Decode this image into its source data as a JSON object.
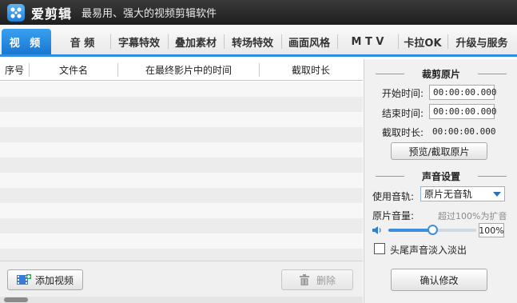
{
  "app": {
    "name": "爱剪辑",
    "slogan": "最易用、强大的视频剪辑软件"
  },
  "tabs": [
    {
      "label": "视 频",
      "active": true
    },
    {
      "label": "音 频"
    },
    {
      "label": "字幕特效"
    },
    {
      "label": "叠加素材"
    },
    {
      "label": "转场特效"
    },
    {
      "label": "画面风格"
    },
    {
      "label": "M T V"
    },
    {
      "label": "卡拉OK"
    },
    {
      "label": "升级与服务"
    }
  ],
  "list": {
    "columns": [
      "序号",
      "文件名",
      "在最终影片中的时间",
      "截取时长"
    ],
    "add_button": "添加视频",
    "delete_button": "删除"
  },
  "clip": {
    "section_title": "裁剪原片",
    "start_label": "开始时间:",
    "start_value": "00:00:00.000",
    "end_label": "结束时间:",
    "end_value": "00:00:00.000",
    "duration_label": "截取时长:",
    "duration_value": "00:00:00.000",
    "preview_button": "预览/截取原片"
  },
  "audio": {
    "section_title": "声音设置",
    "track_label": "使用音轨:",
    "track_value": "原片无音轨",
    "volume_label": "原片音量:",
    "volume_hint": "超过100%为扩音",
    "volume_percent": "100%",
    "volume_level": 0.5,
    "fade_label": "头尾声音淡入淡出",
    "fade_checked": false,
    "confirm_button": "确认修改"
  },
  "colors": {
    "accent": "#2b8de3",
    "titlebar": "#2a2a2a"
  }
}
